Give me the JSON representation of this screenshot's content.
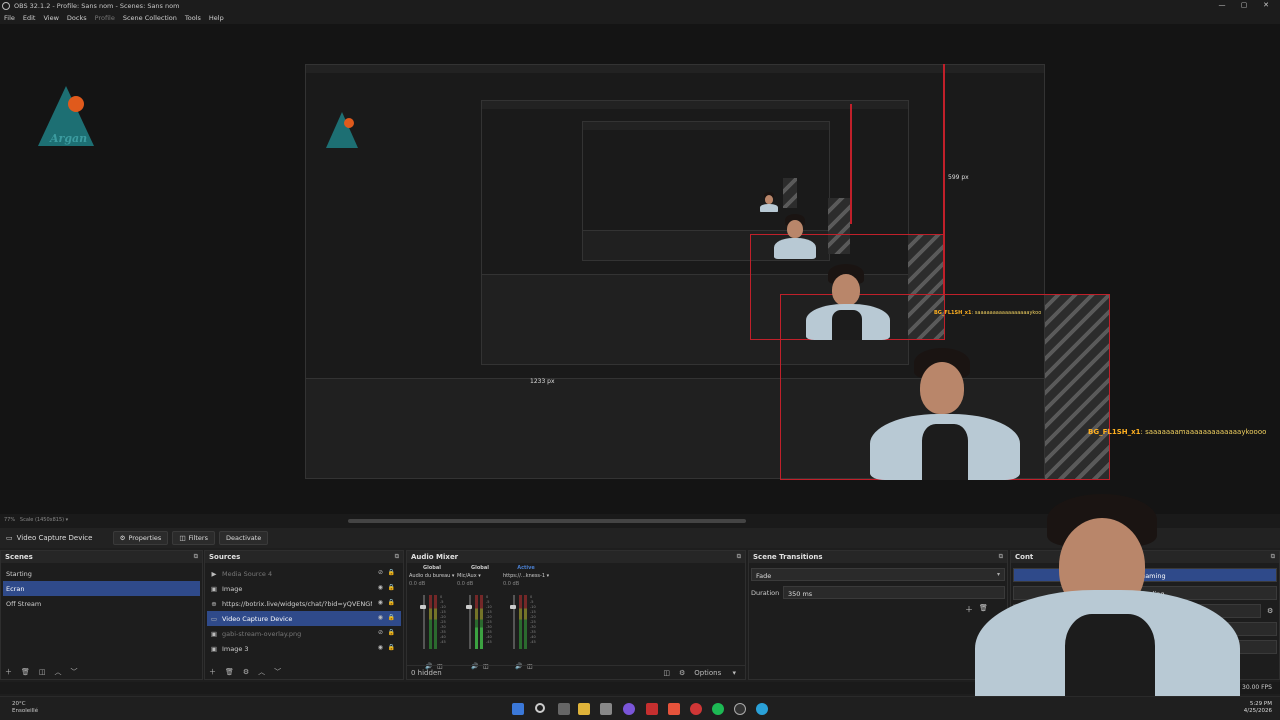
{
  "window": {
    "title": "OBS 32.1.2 - Profile: Sans nom - Scenes: Sans nom",
    "minimize": "—",
    "maximize": "▢",
    "close": "✕"
  },
  "menu": {
    "file": "File",
    "edit": "Edit",
    "view": "View",
    "docks": "Docks",
    "profile": "Profile",
    "scene_collection": "Scene Collection",
    "tools": "Tools",
    "help": "Help"
  },
  "preview": {
    "logo_text": "Argan",
    "chat_user": "BG_FL1SH_x1",
    "chat_message": ": saaaaaaamaaaaaaaaaaaaaykoooo",
    "chat_user_small": "BG_FL1SH_x1",
    "chat_message_small": ": saaaaaaaaaaaaaaaaaykoo",
    "dim_height": "599 px",
    "dim_width": "1233 px",
    "zoom_label": "77%",
    "scale_label": "Scale (1450x815)"
  },
  "source_toolbar": {
    "source_name": "Video Capture Device",
    "properties": "Properties",
    "filters": "Filters",
    "deactivate": "Deactivate"
  },
  "scenes": {
    "title": "Scenes",
    "items": [
      {
        "label": "Starting",
        "selected": false
      },
      {
        "label": "Ecran",
        "selected": true
      },
      {
        "label": "Off Stream",
        "selected": false
      }
    ]
  },
  "sources": {
    "title": "Sources",
    "items": [
      {
        "label": "Media Source 4",
        "icon": "▶",
        "selected": false,
        "dim": true
      },
      {
        "label": "Image",
        "icon": "▣",
        "selected": false,
        "dim": false
      },
      {
        "label": "https://botrix.live/widgets/chat/?bid=yQVENGN%2E",
        "icon": "⊕",
        "selected": false,
        "dim": false
      },
      {
        "label": "Video Capture Device",
        "icon": "▭",
        "selected": true,
        "dim": false
      },
      {
        "label": "gabi-stream-overlay.png",
        "icon": "▣",
        "selected": false,
        "dim": true
      },
      {
        "label": "Image 3",
        "icon": "▣",
        "selected": false,
        "dim": false
      }
    ]
  },
  "audio_mixer": {
    "title": "Audio Mixer",
    "channels": [
      {
        "group": "Global",
        "name": "Audio du bureau",
        "db": "0.0 dB",
        "active": false
      },
      {
        "group": "Global",
        "name": "Mic/Aux",
        "db": "0.0 dB",
        "active": false
      },
      {
        "group": "Active",
        "name": "https://...kness-1",
        "db": "0.0 dB",
        "active": true
      }
    ],
    "hidden": "0 hidden",
    "options": "Options"
  },
  "transitions": {
    "title": "Scene Transitions",
    "selected": "Fade",
    "duration_label": "Duration",
    "duration_value": "350 ms"
  },
  "controls": {
    "title": "Cont",
    "streaming": "Streaming",
    "recording": "Recording"
  },
  "status": {
    "fps": "0.00 / 30.00 FPS"
  },
  "taskbar": {
    "temperature": "20°C",
    "weather": "Ensoleillé",
    "time": "5:29 PM",
    "date": "4/25/2026"
  }
}
